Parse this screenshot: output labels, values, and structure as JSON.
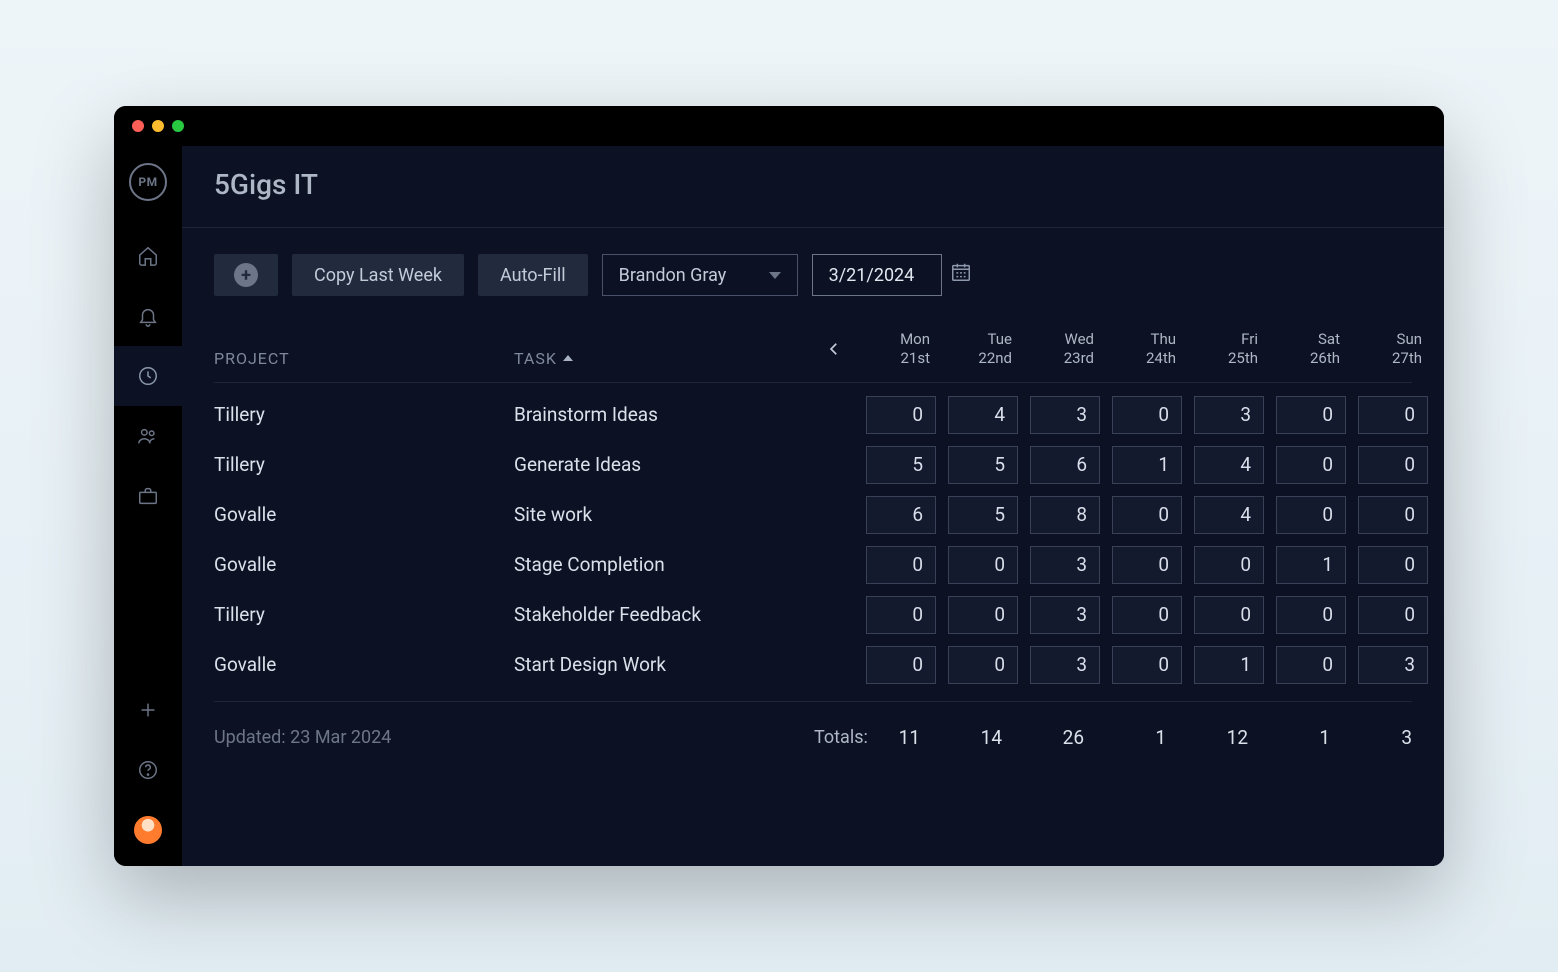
{
  "logo_text": "PM",
  "header": {
    "title": "5Gigs IT"
  },
  "toolbar": {
    "copy_last_week": "Copy Last Week",
    "auto_fill": "Auto-Fill",
    "user_select": "Brandon Gray",
    "date_picker": "3/21/2024"
  },
  "columns": {
    "project_label": "PROJECT",
    "task_label": "TASK"
  },
  "days": [
    {
      "dow": "Mon",
      "ord": "21st"
    },
    {
      "dow": "Tue",
      "ord": "22nd"
    },
    {
      "dow": "Wed",
      "ord": "23rd"
    },
    {
      "dow": "Thu",
      "ord": "24th"
    },
    {
      "dow": "Fri",
      "ord": "25th"
    },
    {
      "dow": "Sat",
      "ord": "26th"
    },
    {
      "dow": "Sun",
      "ord": "27th"
    }
  ],
  "rows": [
    {
      "project": "Tillery",
      "task": "Brainstorm Ideas",
      "values": [
        0,
        4,
        3,
        0,
        3,
        0,
        0
      ]
    },
    {
      "project": "Tillery",
      "task": "Generate Ideas",
      "values": [
        5,
        5,
        6,
        1,
        4,
        0,
        0
      ]
    },
    {
      "project": "Govalle",
      "task": "Site work",
      "values": [
        6,
        5,
        8,
        0,
        4,
        0,
        0
      ]
    },
    {
      "project": "Govalle",
      "task": "Stage Completion",
      "values": [
        0,
        0,
        3,
        0,
        0,
        1,
        0
      ]
    },
    {
      "project": "Tillery",
      "task": "Stakeholder Feedback",
      "values": [
        0,
        0,
        3,
        0,
        0,
        0,
        0
      ]
    },
    {
      "project": "Govalle",
      "task": "Start Design Work",
      "values": [
        0,
        0,
        3,
        0,
        1,
        0,
        3
      ]
    }
  ],
  "footer": {
    "updated": "Updated: 23 Mar 2024",
    "totals_label": "Totals:",
    "totals": [
      11,
      14,
      26,
      1,
      12,
      1,
      3
    ]
  }
}
